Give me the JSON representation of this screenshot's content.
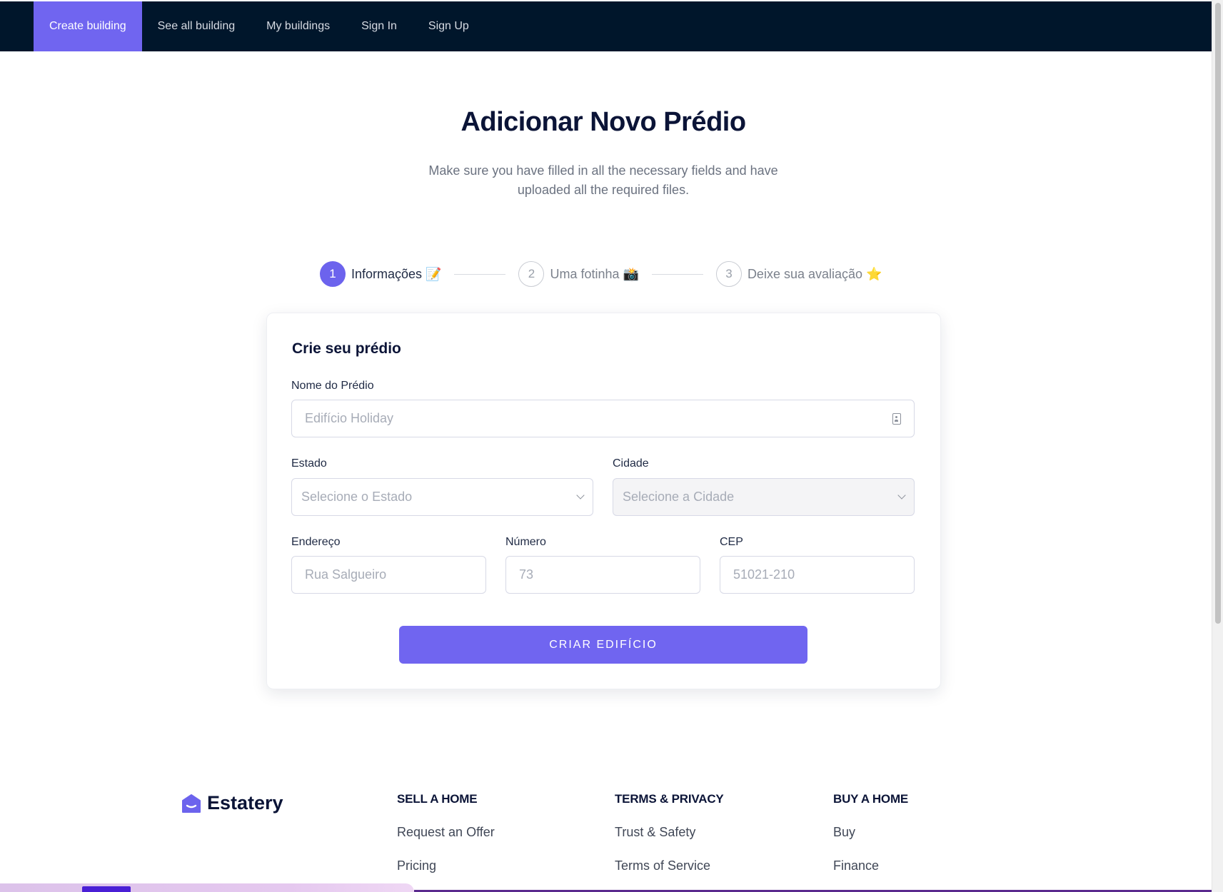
{
  "nav": {
    "items": [
      {
        "label": "Create building",
        "active": true
      },
      {
        "label": "See all building",
        "active": false
      },
      {
        "label": "My buildings",
        "active": false
      },
      {
        "label": "Sign In",
        "active": false
      },
      {
        "label": "Sign Up",
        "active": false
      }
    ]
  },
  "header": {
    "title": "Adicionar Novo Prédio",
    "subtitle": "Make sure you have filled in all the necessary fields and have uploaded all the required files."
  },
  "stepper": {
    "current_step": 1,
    "steps": [
      {
        "number": "1",
        "label": "Informações 📝"
      },
      {
        "number": "2",
        "label": "Uma fotinha 📸"
      },
      {
        "number": "3",
        "label": "Deixe sua avaliação ⭐"
      }
    ]
  },
  "form": {
    "title": "Crie seu prédio",
    "building_name": {
      "label": "Nome do Prédio",
      "placeholder": "Edifício Holiday",
      "value": ""
    },
    "state": {
      "label": "Estado",
      "placeholder": "Selecione o Estado"
    },
    "city": {
      "label": "Cidade",
      "placeholder": "Selecione a Cidade",
      "disabled": true
    },
    "address": {
      "label": "Endereço",
      "placeholder": "Rua Salgueiro",
      "value": ""
    },
    "number": {
      "label": "Número",
      "placeholder": "73",
      "value": ""
    },
    "cep": {
      "label": "CEP",
      "placeholder": "51021-210",
      "value": ""
    },
    "submit_label": "CRIAR EDIFÍCIO"
  },
  "footer": {
    "brand": "Estatery",
    "columns": [
      {
        "heading": "SELL A HOME",
        "links": [
          "Request an Offer",
          "Pricing"
        ]
      },
      {
        "heading": "TERMS & PRIVACY",
        "links": [
          "Trust & Safety",
          "Terms of Service"
        ]
      },
      {
        "heading": "BUY A HOME",
        "links": [
          "Buy",
          "Finance"
        ]
      }
    ]
  },
  "colors": {
    "accent": "#7065f0",
    "nav_background": "#00162b",
    "text_dark": "#0b1437"
  },
  "icons": {
    "building_name_field": "id-badge-icon",
    "select_caret": "chevron-down-icon",
    "brand": "house-logo-icon"
  }
}
